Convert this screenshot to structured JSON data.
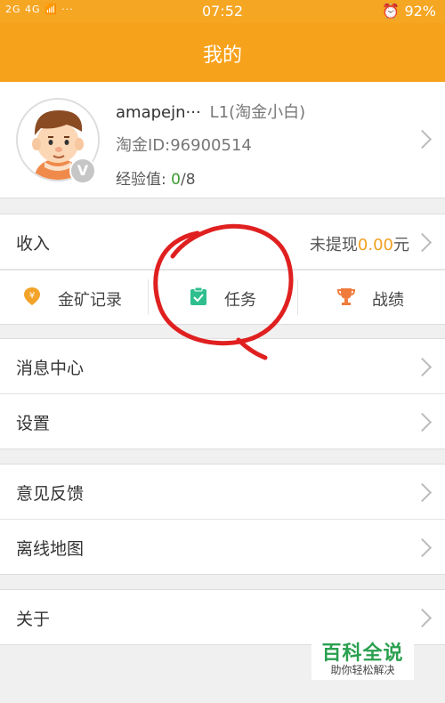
{
  "status_bar": {
    "left": "2G 4G 📶 ···",
    "time": "07:52",
    "battery": "92%"
  },
  "header": {
    "title": "我的"
  },
  "profile": {
    "username": "amapejn···",
    "level": "L1(淘金小白)",
    "id_text": "淘金ID:96900514",
    "exp_label": "经验值:",
    "exp_current": "0",
    "exp_total": "/8",
    "badge": "V"
  },
  "income": {
    "label": "收入",
    "status": "未提现",
    "amount": "0.00",
    "unit": "元"
  },
  "quick_links": [
    {
      "label": "金矿记录",
      "icon": "yuan-location-icon",
      "color": "#f3a32a"
    },
    {
      "label": "任务",
      "icon": "clipboard-check-icon",
      "color": "#2fbf8f"
    },
    {
      "label": "战绩",
      "icon": "trophy-icon",
      "color": "#f07b3c"
    }
  ],
  "menu_group_1": [
    "消息中心",
    "设置"
  ],
  "menu_group_2": [
    "意见反馈",
    "离线地图"
  ],
  "menu_group_3": [
    "关于"
  ],
  "watermark": {
    "title": "百科全说",
    "subtitle": "助你轻松解决"
  },
  "colors": {
    "accent": "#f7a21b",
    "annotation": "#e02020"
  }
}
